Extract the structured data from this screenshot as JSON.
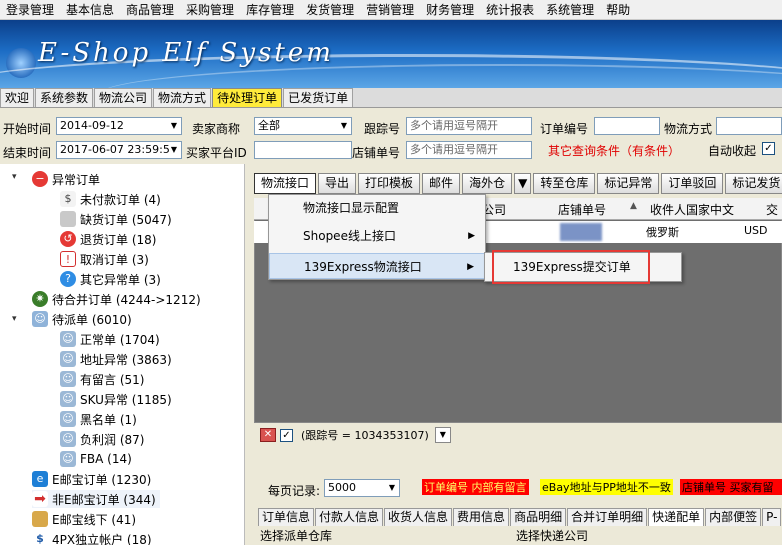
{
  "menubar": [
    "登录管理",
    "基本信息",
    "商品管理",
    "采购管理",
    "库存管理",
    "发货管理",
    "营销管理",
    "财务管理",
    "统计报表",
    "系统管理",
    "帮助"
  ],
  "banner": {
    "title": "E-Shop Elf System"
  },
  "tabs": [
    "欢迎",
    "系统参数",
    "物流公司",
    "物流方式",
    "待处理订单",
    "已发货订单"
  ],
  "active_tab": "待处理订单",
  "filters": {
    "start_label": "开始时间",
    "start_value": "2014-09-12",
    "end_label": "结束时间",
    "end_value": "2017-06-07  23:59:5",
    "seller_label": "卖家商称",
    "seller_value": "全部",
    "platform_label": "买家平台ID",
    "tracking_label": "跟踪号",
    "tracking_placeholder": "多个请用逗号隔开",
    "store_label": "店铺单号",
    "store_placeholder": "多个请用逗号隔开",
    "order_label": "订单编号",
    "logistics_label": "物流方式",
    "other_conditions": "其它查询条件（有条件）",
    "auto_collapse": "自动收起"
  },
  "tree": [
    {
      "label": "异常订单",
      "icon": "error-icon"
    },
    {
      "label": "未付款订单 (4)",
      "icon": "dollar-icon"
    },
    {
      "label": "缺货订单 (5047)",
      "icon": "box-icon"
    },
    {
      "label": "退货订单 (18)",
      "icon": "return-icon"
    },
    {
      "label": "取消订单 (3)",
      "icon": "warning-icon"
    },
    {
      "label": "其它异常单 (3)",
      "icon": "question-icon"
    },
    {
      "label": "待合并订单 (4244->1212)",
      "icon": "gear-icon"
    },
    {
      "label": "待派单 (6010)",
      "icon": "users-icon"
    },
    {
      "label": "正常单 (1704)",
      "icon": "user-icon"
    },
    {
      "label": "地址异常 (3863)",
      "icon": "user-icon"
    },
    {
      "label": "有留言 (51)",
      "icon": "user-icon"
    },
    {
      "label": "SKU异常 (1185)",
      "icon": "user-icon"
    },
    {
      "label": "黑名单 (1)",
      "icon": "user-icon"
    },
    {
      "label": "负利润 (87)",
      "icon": "user-icon"
    },
    {
      "label": "FBA (14)",
      "icon": "user-icon"
    },
    {
      "label": "E邮宝订单 (1230)",
      "icon": "e-icon"
    },
    {
      "label": "非E邮宝订单 (344)",
      "icon": "arrow-icon"
    },
    {
      "label": "E邮宝线下 (41)",
      "icon": "package-icon"
    },
    {
      "label": "4PX独立帐户 (18)",
      "icon": "dollar-icon"
    }
  ],
  "toolbar": [
    "物流接口",
    "导出",
    "打印模板",
    "邮件",
    "海外仓",
    "转至仓库",
    "标记异常",
    "订单驳回",
    "标记发货"
  ],
  "grid": {
    "headers": [
      "公司",
      "店铺单号",
      "收件人国家中文",
      "交"
    ],
    "row": {
      "country": "俄罗斯",
      "currency": "USD"
    }
  },
  "context_menu": [
    "物流接口显示配置",
    "Shopee线上接口",
    "139Express物流接口"
  ],
  "submenu": [
    "139Express提交订单"
  ],
  "status": {
    "tracking": "(跟踪号 = 1034353107)"
  },
  "paging": {
    "label": "每页记录:",
    "value": "5000"
  },
  "legend": [
    {
      "text": "订单编号  内部有留言",
      "color": "#ff0000",
      "textcolor": "#ffff66"
    },
    {
      "text": "eBay地址与PP地址不一致",
      "color": "#ffff00",
      "textcolor": "#000000"
    },
    {
      "text": "店铺单号  买家有留",
      "color": "#ff0000",
      "textcolor": "#000000"
    }
  ],
  "bottom_tabs": [
    "订单信息",
    "付款人信息",
    "收货人信息",
    "费用信息",
    "商品明细",
    "合并订单明细",
    "快递配单",
    "内部便签",
    "P-"
  ],
  "bottom_labels": {
    "warehouse": "选择派单仓库",
    "courier": "选择快递公司"
  }
}
